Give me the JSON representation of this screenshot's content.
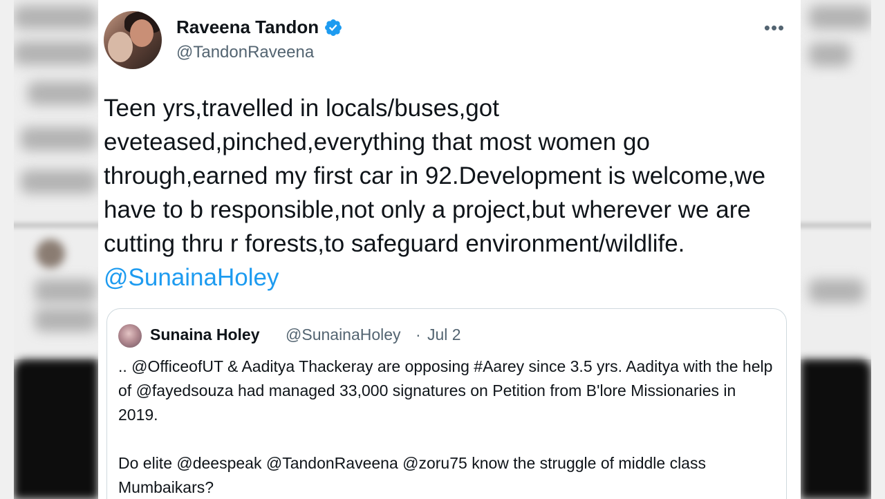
{
  "author": {
    "name": "Raveena Tandon",
    "handle": "@TandonRaveena"
  },
  "icons": {
    "verified": "verified-badge-icon",
    "more": "more-options-icon"
  },
  "more_label": "•••",
  "tweet": {
    "text": "Teen yrs,travelled in locals/buses,got eveteased,pinched,everything that most women go through,earned my first car in 92.Development is welcome,we have to b responsible,not only a project,but wherever we are cutting thru r forests,to safeguard environment/wildlife.",
    "mention": "@SunainaHoley"
  },
  "quoted": {
    "name": "Sunaina Holey",
    "handle": "@SunainaHoley",
    "separator": "·",
    "date": "Jul 2",
    "paragraph1": ".. @OfficeofUT & Aaditya Thackeray are opposing #Aarey since 3.5 yrs. Aaditya with the help of @fayedsouza had managed 33,000 signatures on Petition from B'lore Missionaries in 2019.",
    "paragraph2": "Do elite @deespeak @TandonRaveena @zoru75 know the struggle of middle class Mumbaikars?"
  },
  "colors": {
    "link": "#1d9bf0",
    "text": "#0f1419",
    "secondary": "#536471",
    "border": "#cfd9de"
  }
}
